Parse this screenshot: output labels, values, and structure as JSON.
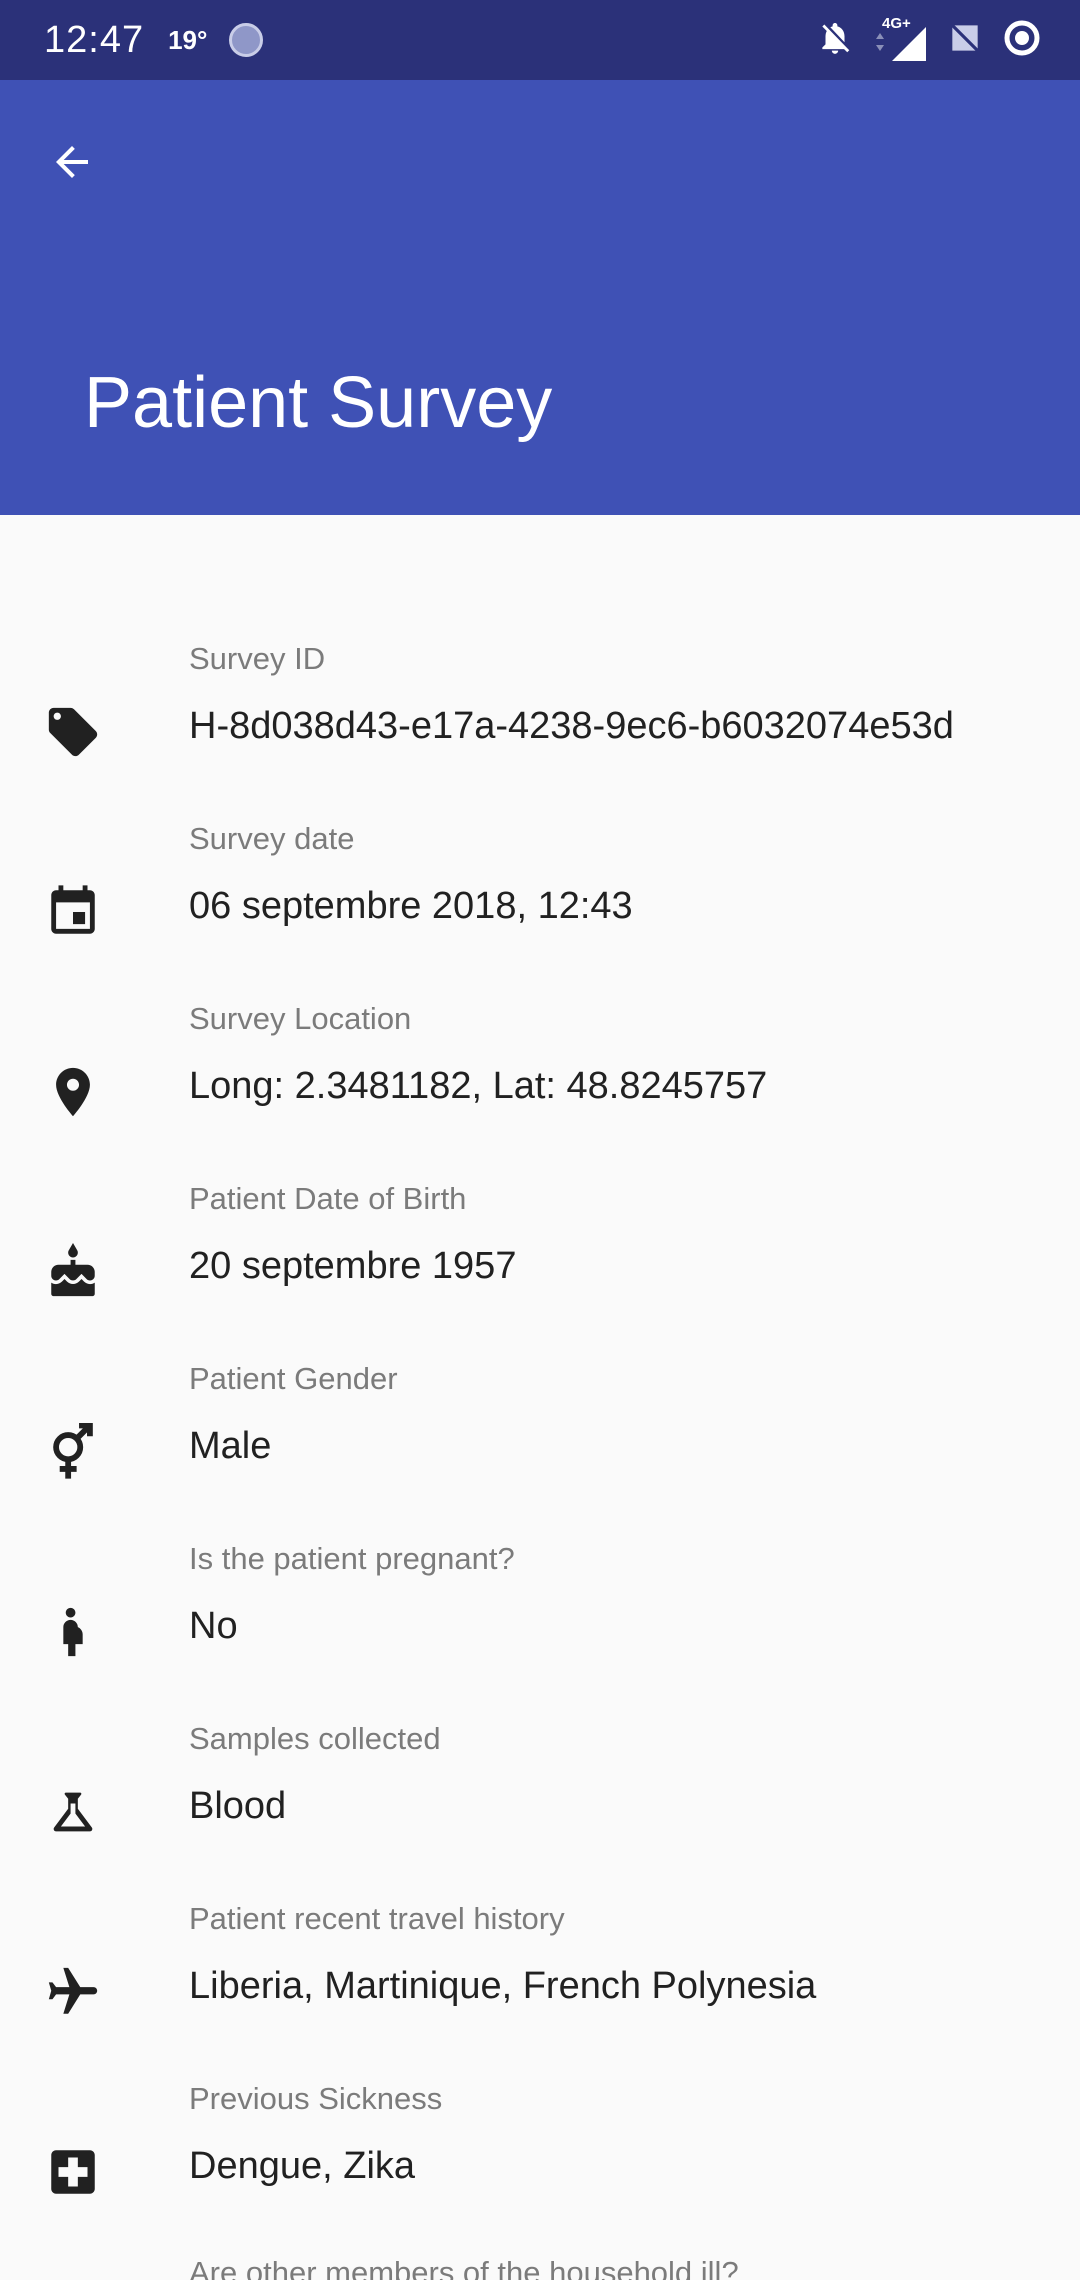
{
  "status_bar": {
    "time": "12:47",
    "temperature": "19°",
    "network": "4G+"
  },
  "app_bar": {
    "title": "Patient Survey",
    "background": "#3f51b5",
    "status_background": "#2b3179"
  },
  "fields": [
    {
      "label": "Survey ID",
      "value": "H-8d038d43-e17a-4238-9ec6-b6032074e53d",
      "icon": "tag-icon"
    },
    {
      "label": "Survey date",
      "value": "06 septembre 2018, 12:43",
      "icon": "calendar-icon"
    },
    {
      "label": "Survey Location",
      "value": "Long: 2.3481182, Lat: 48.8245757",
      "icon": "location-pin-icon"
    },
    {
      "label": "Patient Date of Birth",
      "value": "20 septembre 1957",
      "icon": "cake-icon"
    },
    {
      "label": "Patient Gender",
      "value": "Male",
      "icon": "gender-icon"
    },
    {
      "label": "Is the patient pregnant?",
      "value": "No",
      "icon": "pregnant-woman-icon"
    },
    {
      "label": "Samples collected",
      "value": "Blood",
      "icon": "flask-icon"
    },
    {
      "label": "Patient recent travel history",
      "value": "Liberia, Martinique, French Polynesia",
      "icon": "airplane-icon"
    },
    {
      "label": "Previous Sickness",
      "value": "Dengue, Zika",
      "icon": "medical-cross-icon"
    }
  ],
  "partial_next_label": "Are other members of the household ill?"
}
